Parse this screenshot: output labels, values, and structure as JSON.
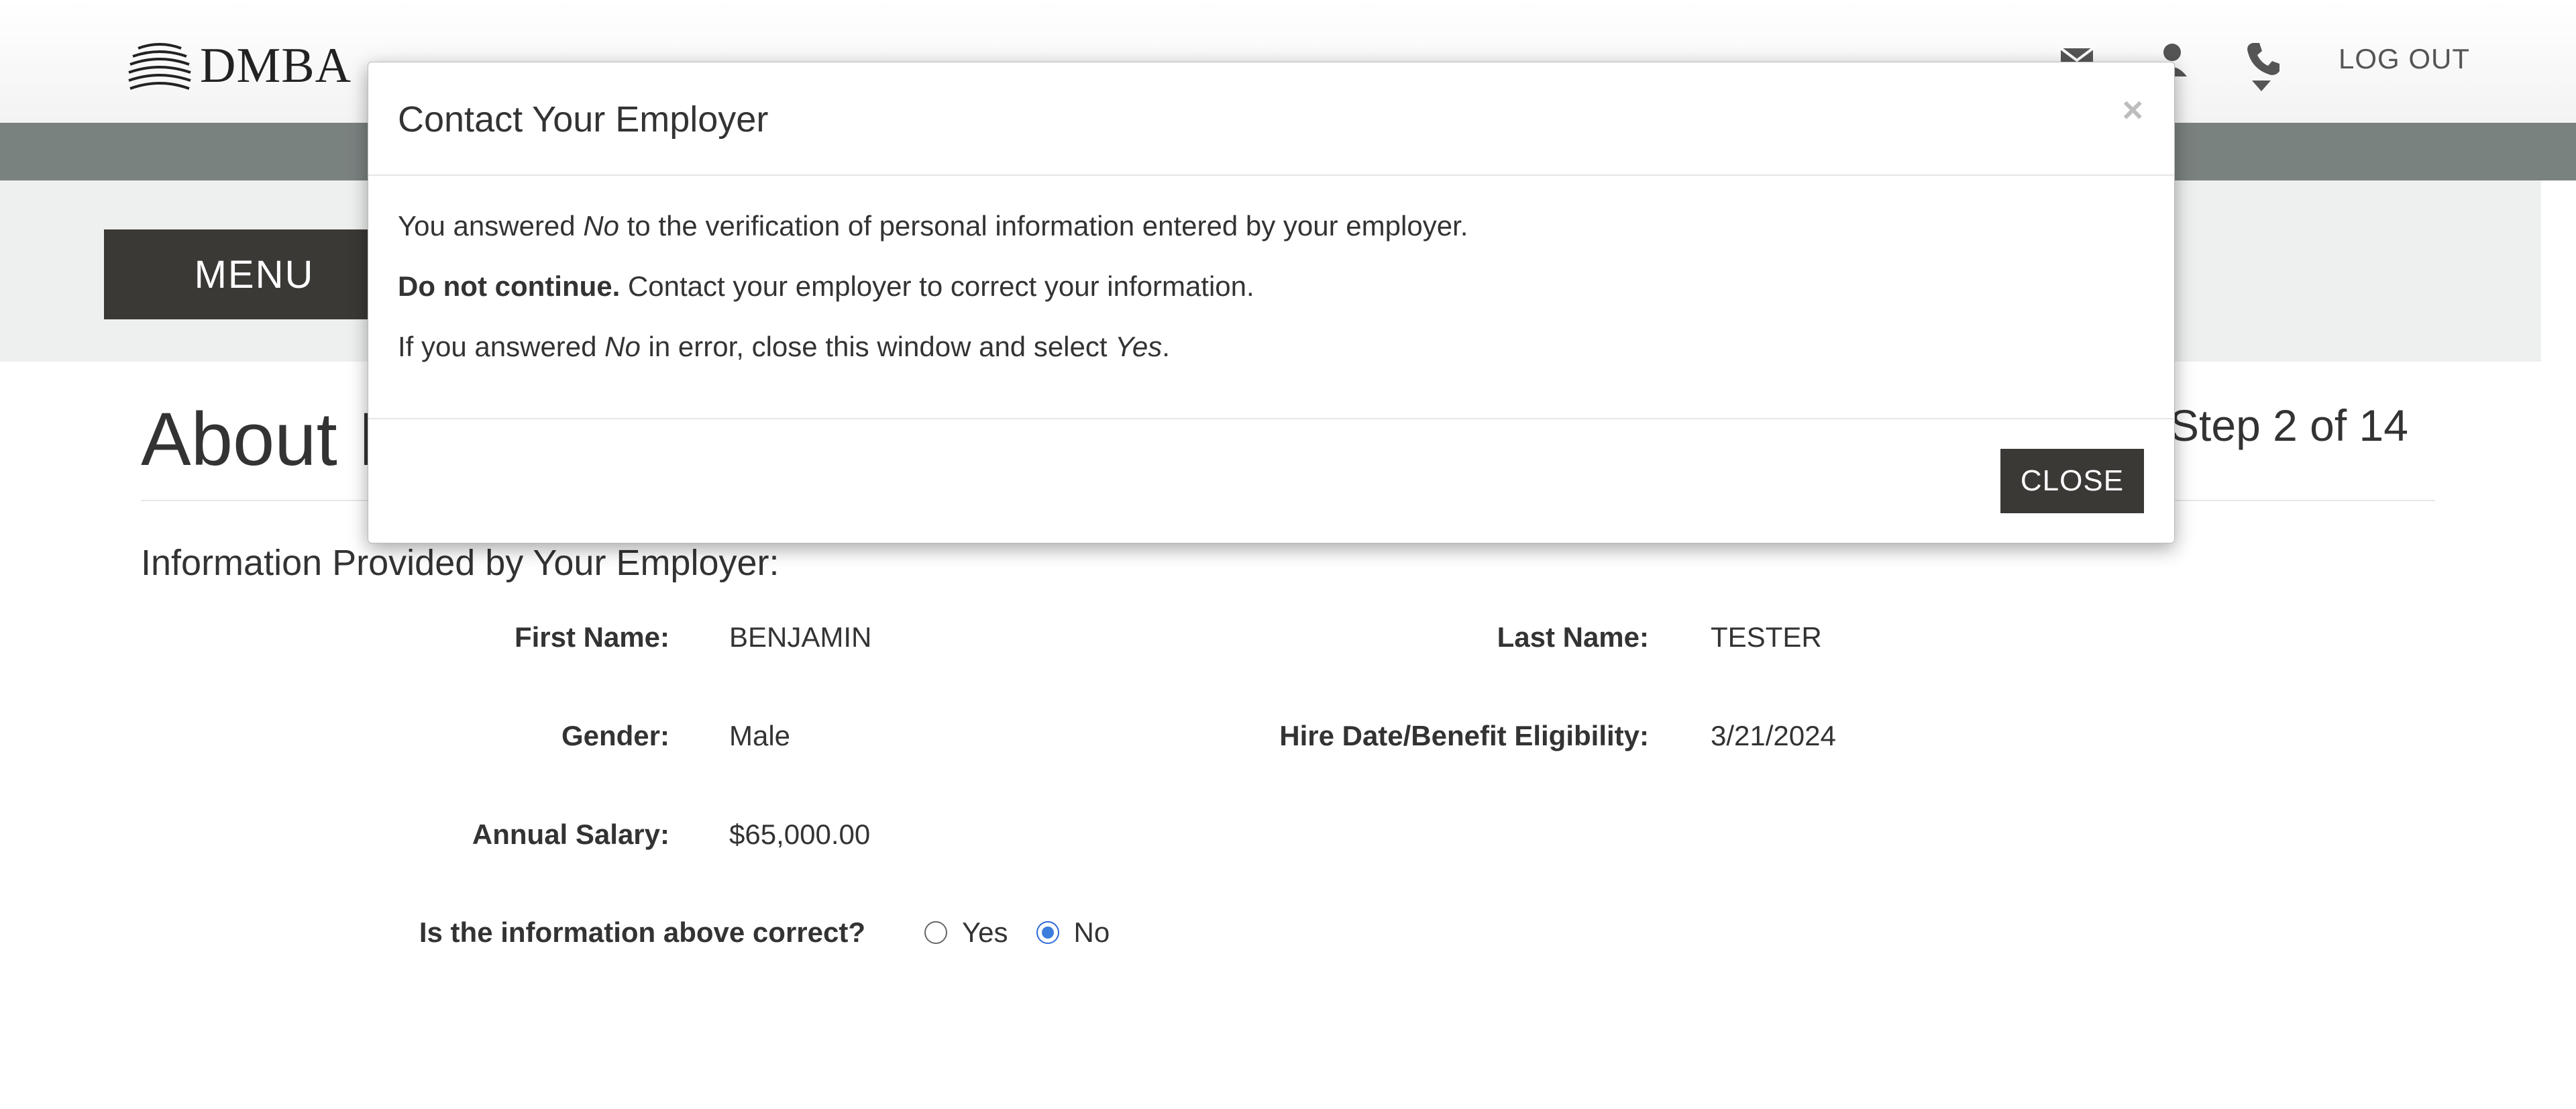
{
  "header": {
    "brand": "DMBA",
    "logout_label": "LOG OUT",
    "icons": [
      "mail-icon",
      "user-icon",
      "phone-icon"
    ]
  },
  "nav": {
    "menu_label": "MENU"
  },
  "page": {
    "title_visible": "About M",
    "step_text": "Step 2 of 14",
    "section_heading": "Information Provided by Your Employer:"
  },
  "fields": {
    "first_name_label": "First Name:",
    "first_name_value": "BENJAMIN",
    "last_name_label": "Last Name:",
    "last_name_value": "TESTER",
    "gender_label": "Gender:",
    "gender_value": "Male",
    "hire_date_label": "Hire Date/Benefit Eligibility:",
    "hire_date_value": "3/21/2024",
    "salary_label": "Annual Salary:",
    "salary_value": "$65,000.00"
  },
  "question": {
    "label": "Is the information above correct?",
    "options": [
      "Yes",
      "No"
    ],
    "selected": "No"
  },
  "modal": {
    "title": "Contact Your Employer",
    "close_x": "×",
    "line1_pre": "You answered ",
    "line1_em": "No",
    "line1_post": " to the verification of personal information entered by your employer.",
    "line2_strong": "Do not continue.",
    "line2_post": " Contact your employer to correct your information.",
    "line3_pre": "If you answered ",
    "line3_em1": "No",
    "line3_mid": " in error, close this window and select ",
    "line3_em2": "Yes",
    "line3_post": ".",
    "close_button": "CLOSE"
  },
  "colors": {
    "dark_button": "#3b3936",
    "subbar": "#7a8280",
    "band": "#eef0ef",
    "radio_selected": "#3b7ddd"
  }
}
